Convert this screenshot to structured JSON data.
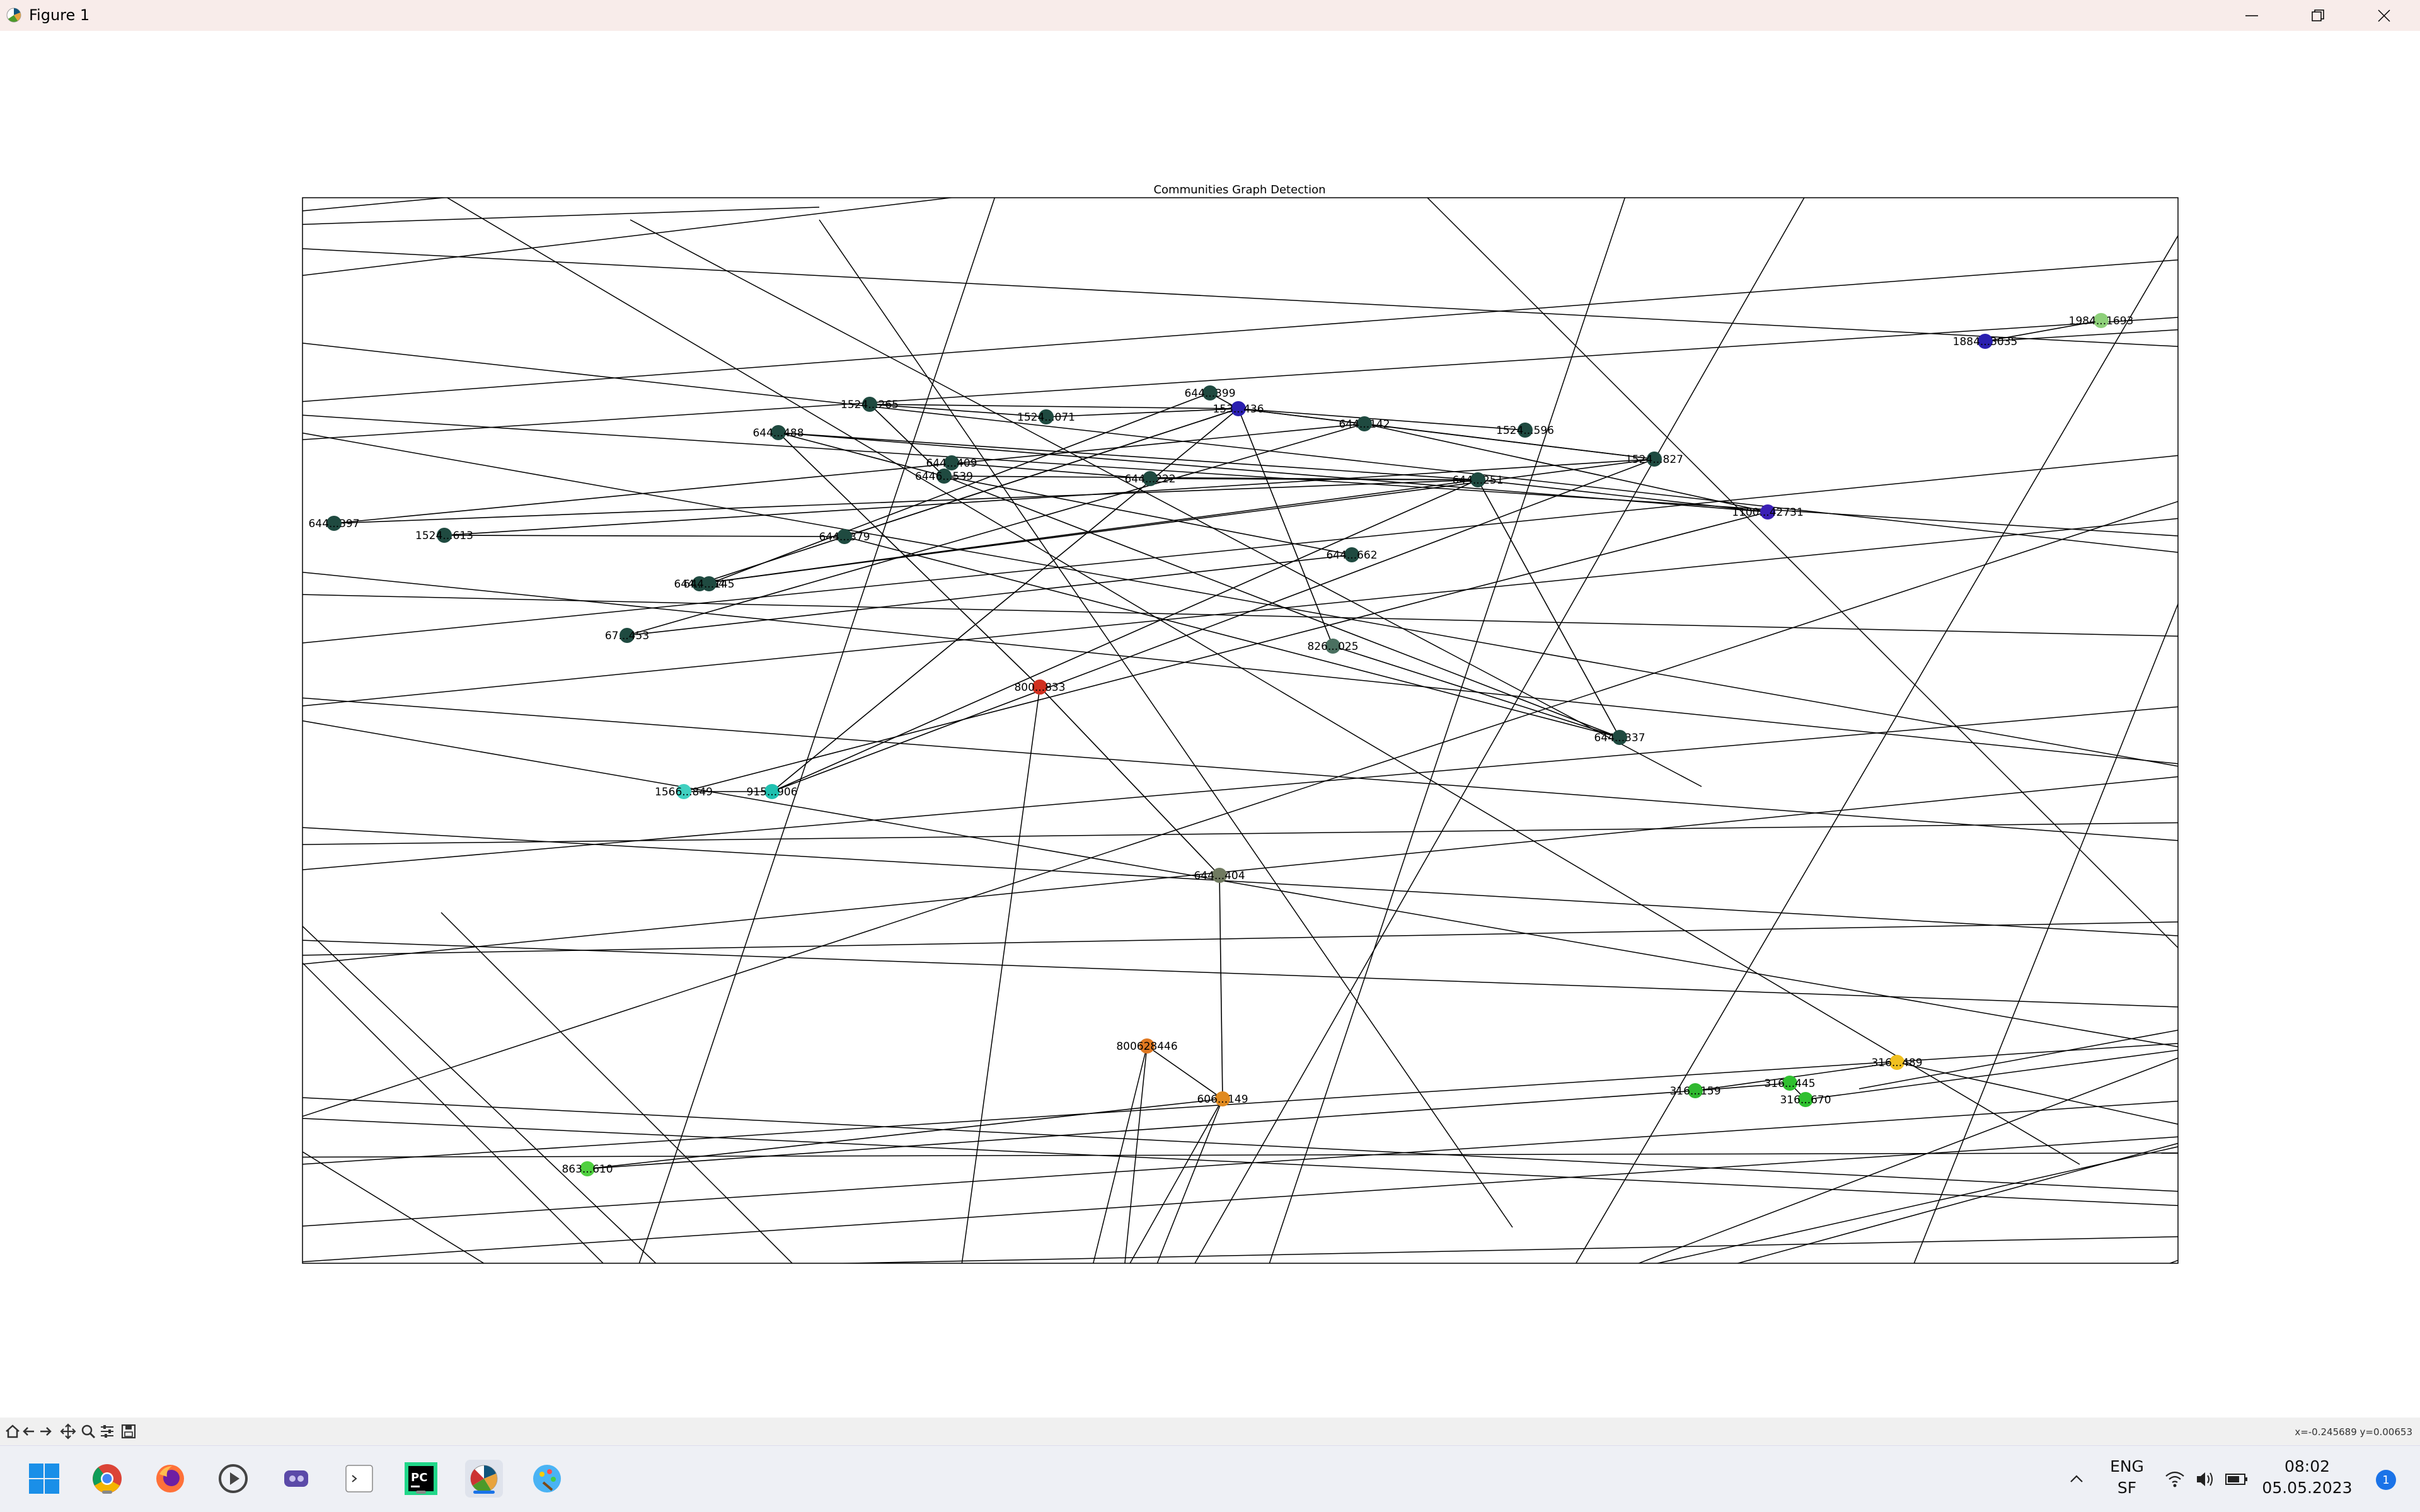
{
  "window": {
    "title": "Figure 1",
    "icons": [
      "matplotlib-icon",
      "minimize-icon",
      "maximize-icon",
      "close-icon"
    ]
  },
  "figure": {
    "title": "Communities Graph Detection"
  },
  "graph": {
    "nodes": [
      {
        "label": "1524...265",
        "color": "#1f4a40"
      },
      {
        "label": "1524...071",
        "color": "#1f4a40"
      },
      {
        "label": "644...399",
        "color": "#1f4a40"
      },
      {
        "label": "153...436",
        "color": "#2a1fb0"
      },
      {
        "label": "644...488",
        "color": "#1f4a40"
      },
      {
        "label": "644...409",
        "color": "#1f4a40"
      },
      {
        "label": "644...142",
        "color": "#1f4a40"
      },
      {
        "label": "1524...596",
        "color": "#1f4a40"
      },
      {
        "label": "1524...827",
        "color": "#1f4a40"
      },
      {
        "label": "1884...3035",
        "color": "#2a1fb0"
      },
      {
        "label": "1984...1693",
        "color": "#8ed07a"
      },
      {
        "label": "6446...539",
        "color": "#1f4a40"
      },
      {
        "label": "644...222",
        "color": "#1f4a40"
      },
      {
        "label": "644...251",
        "color": "#1f4a40"
      },
      {
        "label": "1100...42731",
        "color": "#3a1fb5"
      },
      {
        "label": "644...397",
        "color": "#1f4a40"
      },
      {
        "label": "1524...613",
        "color": "#1f4a40"
      },
      {
        "label": "644...379",
        "color": "#1f4a40"
      },
      {
        "label": "644...662",
        "color": "#1f4a40"
      },
      {
        "label": "644...164",
        "color": "#1f4a40"
      },
      {
        "label": "644...145",
        "color": "#1f4a40"
      },
      {
        "label": "67...453",
        "color": "#1f4a40"
      },
      {
        "label": "826...025",
        "color": "#4a7060"
      },
      {
        "label": "800...833",
        "color": "#d03020"
      },
      {
        "label": "644...337",
        "color": "#1f4a40"
      },
      {
        "label": "1566...849",
        "color": "#40d0c0"
      },
      {
        "label": "915...906",
        "color": "#20c0b0"
      },
      {
        "label": "644...404",
        "color": "#707a60"
      },
      {
        "label": "800628446",
        "color": "#e07820"
      },
      {
        "label": "606...149",
        "color": "#e08a20"
      },
      {
        "label": "316...489",
        "color": "#f0c020"
      },
      {
        "label": "316...159",
        "color": "#30b830"
      },
      {
        "label": "316...445",
        "color": "#30c030"
      },
      {
        "label": "316...670",
        "color": "#30c030"
      },
      {
        "label": "863...610",
        "color": "#50d040"
      }
    ]
  },
  "toolbar": {
    "icons": [
      "home-icon",
      "back-icon",
      "forward-icon",
      "pan-icon",
      "zoom-icon",
      "configure-subplots-icon",
      "save-icon"
    ],
    "coords": "x=-0.245689 y=0.00653"
  },
  "taskbar": {
    "apps": [
      "windows-start-icon",
      "chrome-icon",
      "firefox-icon",
      "media-player-icon",
      "vpn-icon",
      "terminal-icon",
      "pycharm-icon",
      "matplotlib-figure-icon",
      "paint-icon"
    ],
    "active_app": "matplotlib-figure-icon",
    "tray": {
      "lang_top": "ENG",
      "lang_bottom": "SF",
      "time": "08:02",
      "date": "05.05.2023",
      "notifications": "1",
      "icons": [
        "chevron-up-icon",
        "wifi-icon",
        "volume-icon",
        "battery-icon"
      ]
    }
  }
}
